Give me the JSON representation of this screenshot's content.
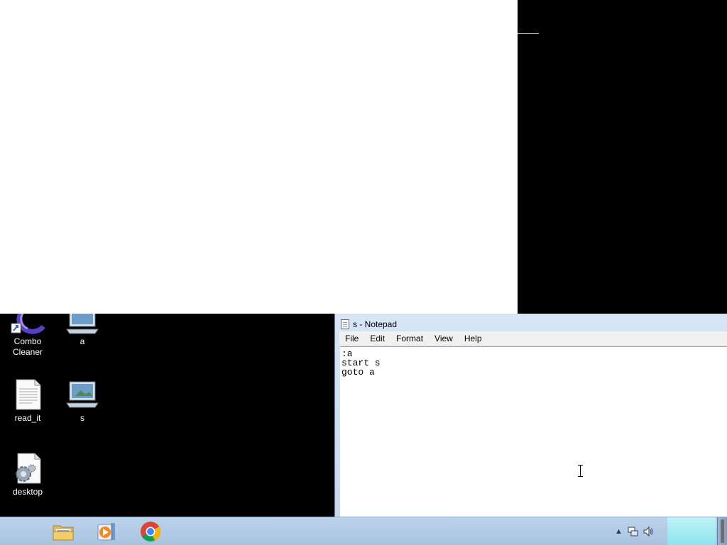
{
  "desktop": {
    "icons": [
      {
        "label": "Combo\nCleaner",
        "icon": "combo-cleaner-icon"
      },
      {
        "label": "a",
        "icon": "batch-file-icon"
      },
      {
        "label": "read_it",
        "icon": "text-file-icon"
      },
      {
        "label": "s",
        "icon": "batch-file-icon"
      },
      {
        "label": "desktop",
        "icon": "settings-file-icon"
      }
    ]
  },
  "notepad": {
    "title": "s - Notepad",
    "menu": [
      "File",
      "Edit",
      "Format",
      "View",
      "Help"
    ],
    "content": ":a\nstart s\ngoto a"
  },
  "taskbar": {
    "pinned": [
      "file-explorer-icon",
      "media-player-icon",
      "chrome-icon"
    ],
    "tray": [
      "show-hidden-icons-arrow",
      "network-icon",
      "volume-icon"
    ]
  },
  "colors": {
    "taskbar": "#a9c3e0",
    "window_frame": "#c4d8ee",
    "desktop": "#000000"
  }
}
